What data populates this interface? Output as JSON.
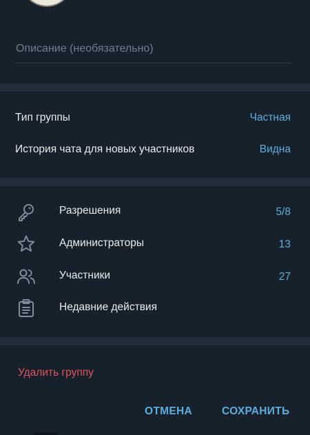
{
  "description_field": {
    "value": "",
    "placeholder": "Описание (необязательно)"
  },
  "settings": [
    {
      "label": "Тип группы",
      "value": "Частная"
    },
    {
      "label": "История чата для новых участников",
      "value": "Видна"
    }
  ],
  "management": [
    {
      "icon": "key-icon",
      "label": "Разрешения",
      "value": "5/8"
    },
    {
      "icon": "star-icon",
      "label": "Администраторы",
      "value": "13"
    },
    {
      "icon": "members-icon",
      "label": "Участники",
      "value": "27"
    },
    {
      "icon": "clipboard-icon",
      "label": "Недавние действия",
      "value": ""
    }
  ],
  "delete_label": "Удалить группу",
  "footer": {
    "cancel_label": "ОТМЕНА",
    "save_label": "СОХРАНИТЬ"
  },
  "colors": {
    "background": "#17212b",
    "separator": "#232e3c",
    "accent": "#5eaddc",
    "danger": "#e0535a",
    "text": "#e8ecf0",
    "muted": "#6d7f8f",
    "icon": "#7f8e9c"
  }
}
